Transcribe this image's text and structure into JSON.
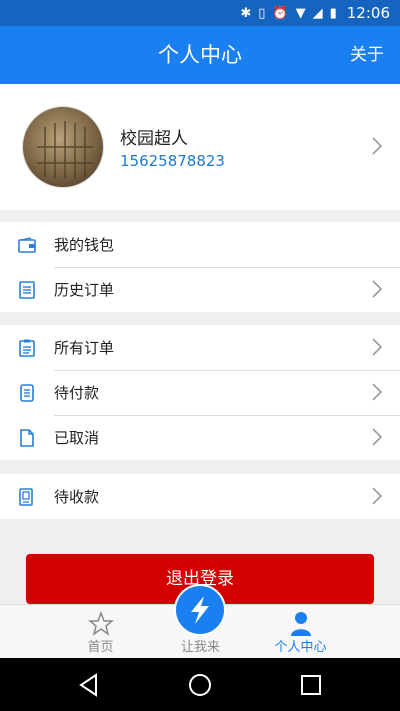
{
  "status_bar": {
    "icons": [
      "bluetooth-icon",
      "vibrate-icon",
      "alarm-icon",
      "wifi-icon",
      "signal-icon",
      "battery-icon"
    ],
    "time": "12:06"
  },
  "app_bar": {
    "title": "个人中心",
    "action": "关于"
  },
  "profile": {
    "name": "校园超人",
    "phone": "15625878823"
  },
  "menu_groups": [
    {
      "items": [
        {
          "label": "我的钱包",
          "icon": "wallet-icon",
          "chevron": false
        },
        {
          "label": "历史订单",
          "icon": "list-icon",
          "chevron": true
        }
      ]
    },
    {
      "items": [
        {
          "label": "所有订单",
          "icon": "clipboard-icon",
          "chevron": true
        },
        {
          "label": "待付款",
          "icon": "bill-icon",
          "chevron": true
        },
        {
          "label": "已取消",
          "icon": "document-icon",
          "chevron": true
        }
      ]
    },
    {
      "items": [
        {
          "label": "待收款",
          "icon": "receipt-icon",
          "chevron": true
        }
      ]
    }
  ],
  "logout_button": "退出登录",
  "tabs": [
    {
      "label": "首页",
      "icon": "star-icon",
      "active": false
    },
    {
      "label": "让我来",
      "icon": "lightning-icon",
      "active": false
    },
    {
      "label": "个人中心",
      "icon": "person-icon",
      "active": true
    }
  ],
  "colors": {
    "primary": "#1a7ff0",
    "status_bar": "#1565c0",
    "logout": "#d40000",
    "link": "#1e79d6"
  },
  "nav_bar": {
    "buttons": [
      "back-icon",
      "home-icon",
      "recents-icon"
    ]
  }
}
